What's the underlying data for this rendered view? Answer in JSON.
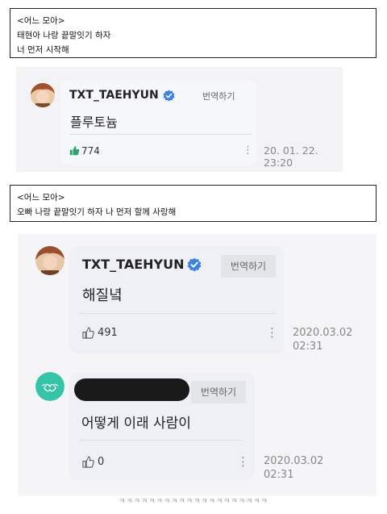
{
  "quote1": {
    "title": "<어느 모아>",
    "line1": "태현아 나랑 끝말잇기 하자",
    "line2": "너 먼저 시작해"
  },
  "post1": {
    "username": "TXT_TAEHYUN",
    "translate": "번역하기",
    "body": "플루토늄",
    "likes": "774",
    "date_line1": "20. 01. 22.",
    "date_line2": "23:20"
  },
  "quote2": {
    "title": "<어느 모아>",
    "line1": "오빠 나랑 끝말잇기 하자 나 먼저 할께 사랑해"
  },
  "post2": {
    "username": "TXT_TAEHYUN",
    "translate": "번역하기",
    "body": "해질녘",
    "likes": "491",
    "date_line1": "2020.03.02",
    "date_line2": "02:31"
  },
  "post3": {
    "translate": "번역하기",
    "body": "어떻게 이래 사람이",
    "likes": "0",
    "date_line1": "2020.03.02",
    "date_line2": "02:31"
  },
  "footer": {
    "text": "ㅋㅋㅋㅋㅋㅋㅋㅋㅋㅋㅋㅋㅋㅋㅋㅋㅋㅋㅋㅋ"
  },
  "colors": {
    "verified": "#3b82e6",
    "like_filled": "#2fa36b",
    "redaction": "#1a1a1a",
    "avatar3": "#35c4a8"
  },
  "icons": [
    "verified-badge-icon",
    "thumbs-up-icon",
    "more-options-icon"
  ]
}
